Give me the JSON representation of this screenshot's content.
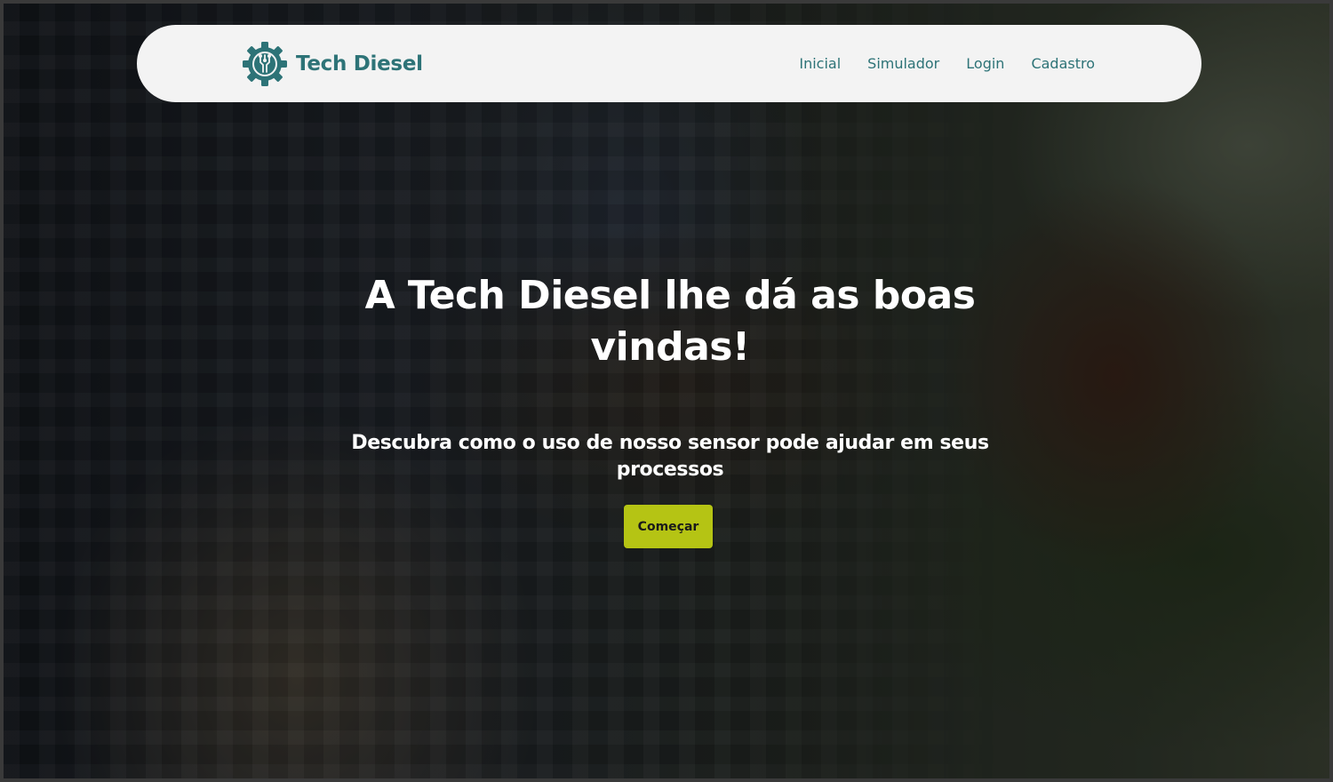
{
  "brand": {
    "name": "Tech Diesel",
    "logo_icon": "gear-circuit-icon",
    "color": "#2d7377"
  },
  "nav": {
    "items": [
      {
        "label": "Inicial"
      },
      {
        "label": "Simulador"
      },
      {
        "label": "Login"
      },
      {
        "label": "Cadastro"
      }
    ]
  },
  "hero": {
    "title": "A Tech Diesel lhe dá as boas vindas!",
    "subtitle": "Descubra como o uso de nosso sensor pode ajudar em seus processos",
    "cta_label": "Começar",
    "cta_color": "#b5c414"
  }
}
